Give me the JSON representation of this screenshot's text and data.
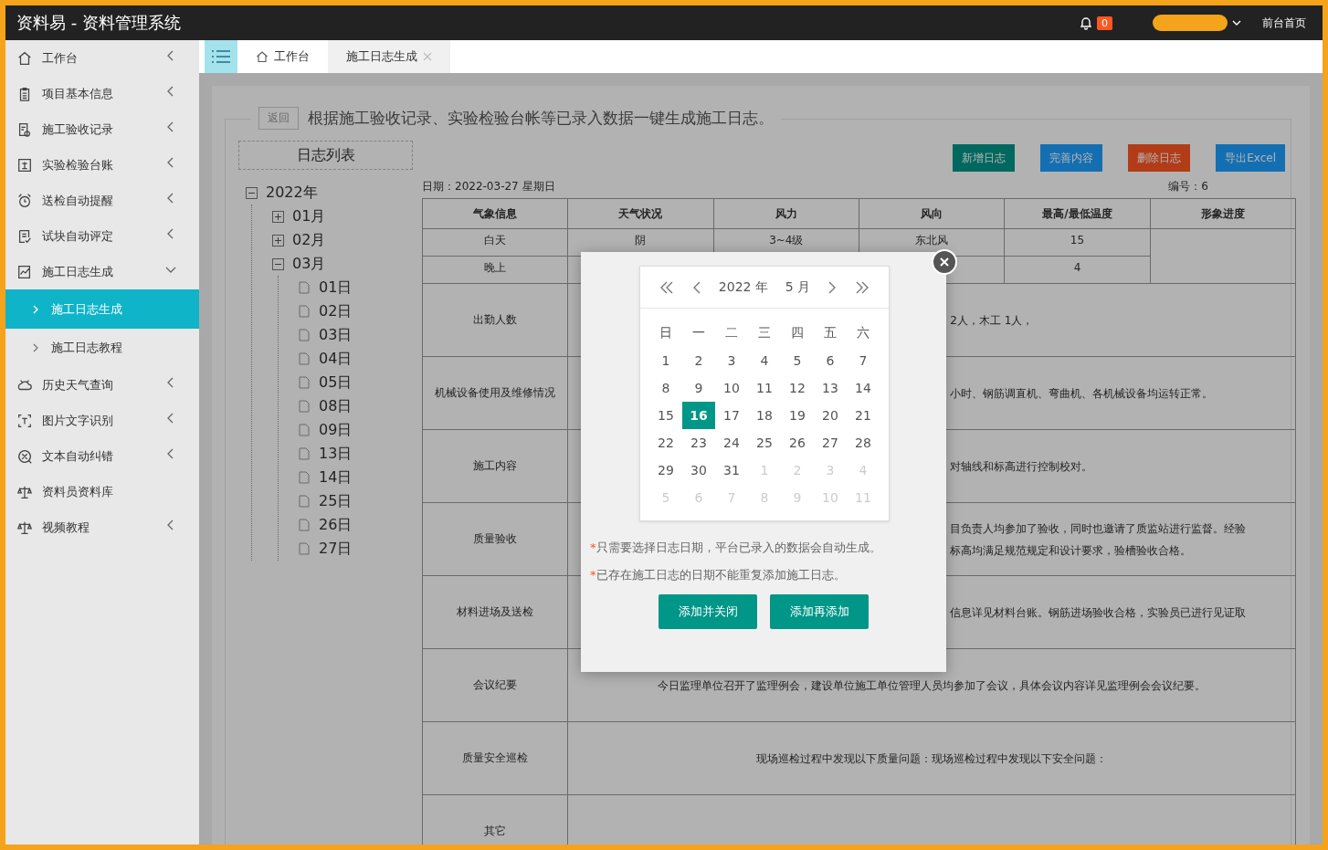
{
  "header": {
    "title": "资料易 - 资料管理系统",
    "notifications": "0",
    "home_link": "前台首页"
  },
  "sidebar": {
    "items": [
      {
        "label": "工作台",
        "expanded": false
      },
      {
        "label": "项目基本信息",
        "expanded": false
      },
      {
        "label": "施工验收记录",
        "expanded": false
      },
      {
        "label": "实验检验台账",
        "expanded": false
      },
      {
        "label": "送检自动提醒",
        "expanded": false
      },
      {
        "label": "试块自动评定",
        "expanded": false
      },
      {
        "label": "施工日志生成",
        "expanded": true,
        "children": [
          {
            "label": "施工日志生成",
            "selected": true
          },
          {
            "label": "施工日志教程",
            "selected": false
          }
        ]
      },
      {
        "label": "历史天气查询",
        "expanded": false
      },
      {
        "label": "图片文字识别",
        "expanded": false
      },
      {
        "label": "文本自动纠错",
        "expanded": false
      },
      {
        "label": "资料员资料库"
      },
      {
        "label": "视频教程",
        "expanded": false
      }
    ]
  },
  "tabs": [
    {
      "label": "工作台",
      "kind": "home",
      "selected": false,
      "closable": false
    },
    {
      "label": "施工日志生成",
      "kind": "page",
      "selected": true,
      "closable": true
    }
  ],
  "page": {
    "back_button": "返回",
    "intro": "根据施工验收记录、实验检验台帐等已录入数据一键生成施工日志。",
    "log_list_title": "日志列表",
    "tree": [
      {
        "label": "2022年",
        "expanded": true,
        "children": [
          {
            "label": "01月",
            "expanded": false
          },
          {
            "label": "02月",
            "expanded": false
          },
          {
            "label": "03月",
            "expanded": true,
            "children": [
              {
                "label": "01日"
              },
              {
                "label": "02日"
              },
              {
                "label": "03日"
              },
              {
                "label": "04日"
              },
              {
                "label": "05日"
              },
              {
                "label": "08日"
              },
              {
                "label": "09日"
              },
              {
                "label": "13日"
              },
              {
                "label": "14日"
              },
              {
                "label": "25日"
              },
              {
                "label": "26日"
              },
              {
                "label": "27日"
              }
            ]
          }
        ]
      }
    ],
    "actions": [
      {
        "label": "新增日志",
        "kind": "primary"
      },
      {
        "label": "完善内容",
        "kind": "normal"
      },
      {
        "label": "删除日志",
        "kind": "danger"
      },
      {
        "label": "导出Excel",
        "kind": "normal"
      }
    ],
    "date": "日期：2022-03-27 星期日",
    "serial": "编号：6",
    "weather_table": {
      "columns": [
        "气象信息",
        "天气状况",
        "风力",
        "风向",
        "最高/最低温度",
        "形象进度"
      ],
      "rows": [
        {
          "period": "白天",
          "weather": "阴",
          "wind_force": "3~4级",
          "wind_direction": "东北风",
          "temperature": "15"
        },
        {
          "period": "晚上",
          "temperature": "4"
        }
      ]
    },
    "log_rows": [
      {
        "label": "出勤人数",
        "covered": true,
        "lines": [
          "2人，木工 1人，"
        ]
      },
      {
        "label": "机械设备使用及维修情况",
        "covered": true,
        "lines": [
          "小时、钢筋调直机、弯曲机、各机械设备均运转正常。"
        ]
      },
      {
        "label": "施工内容",
        "covered": true,
        "lines": [
          "对轴线和标高进行控制校对。"
        ]
      },
      {
        "label": "质量验收",
        "covered": true,
        "lines": [
          "目负责人均参加了验收，同时也邀请了质监站进行监督。经验",
          "标高均满足规范规定和设计要求，验槽验收合格。"
        ]
      },
      {
        "label": "材料进场及送检",
        "covered": true,
        "lines": [
          "信息详见材料台账。钢筋进场验收合格，实验员已进行见证取"
        ]
      },
      {
        "label": "会议纪要",
        "covered": false,
        "lines": [
          "今日监理单位召开了监理例会，建设单位施工单位管理人员均参加了会议，具体会议内容详见监理例会会议纪要。"
        ]
      },
      {
        "label": "质量安全巡检",
        "covered": false,
        "lines": [
          "现场巡检过程中发现以下质量问题：现场巡检过程中发现以下安全问题："
        ]
      },
      {
        "label": "其它",
        "lines": []
      }
    ]
  },
  "dialog": {
    "calendar": {
      "year": "2022 年",
      "month": "5 月",
      "weekdays": [
        "日",
        "一",
        "二",
        "三",
        "四",
        "五",
        "六"
      ],
      "weeks": [
        [
          {
            "label": "1",
            "other_month": false,
            "selected": false
          },
          {
            "label": "2",
            "other_month": false,
            "selected": false
          },
          {
            "label": "3",
            "other_month": false,
            "selected": false
          },
          {
            "label": "4",
            "other_month": false,
            "selected": false
          },
          {
            "label": "5",
            "other_month": false,
            "selected": false
          },
          {
            "label": "6",
            "other_month": false,
            "selected": false
          },
          {
            "label": "7",
            "other_month": false,
            "selected": false
          }
        ],
        [
          {
            "label": "8",
            "other_month": false,
            "selected": false
          },
          {
            "label": "9",
            "other_month": false,
            "selected": false
          },
          {
            "label": "10",
            "other_month": false,
            "selected": false
          },
          {
            "label": "11",
            "other_month": false,
            "selected": false
          },
          {
            "label": "12",
            "other_month": false,
            "selected": false
          },
          {
            "label": "13",
            "other_month": false,
            "selected": false
          },
          {
            "label": "14",
            "other_month": false,
            "selected": false
          }
        ],
        [
          {
            "label": "15",
            "other_month": false,
            "selected": false
          },
          {
            "label": "16",
            "other_month": false,
            "selected": true
          },
          {
            "label": "17",
            "other_month": false,
            "selected": false
          },
          {
            "label": "18",
            "other_month": false,
            "selected": false
          },
          {
            "label": "19",
            "other_month": false,
            "selected": false
          },
          {
            "label": "20",
            "other_month": false,
            "selected": false
          },
          {
            "label": "21",
            "other_month": false,
            "selected": false
          }
        ],
        [
          {
            "label": "22",
            "other_month": false,
            "selected": false
          },
          {
            "label": "23",
            "other_month": false,
            "selected": false
          },
          {
            "label": "24",
            "other_month": false,
            "selected": false
          },
          {
            "label": "25",
            "other_month": false,
            "selected": false
          },
          {
            "label": "26",
            "other_month": false,
            "selected": false
          },
          {
            "label": "27",
            "other_month": false,
            "selected": false
          },
          {
            "label": "28",
            "other_month": false,
            "selected": false
          }
        ],
        [
          {
            "label": "29",
            "other_month": false,
            "selected": false
          },
          {
            "label": "30",
            "other_month": false,
            "selected": false
          },
          {
            "label": "31",
            "other_month": false,
            "selected": false
          },
          {
            "label": "1",
            "other_month": true,
            "selected": false
          },
          {
            "label": "2",
            "other_month": true,
            "selected": false
          },
          {
            "label": "3",
            "other_month": true,
            "selected": false
          },
          {
            "label": "4",
            "other_month": true,
            "selected": false
          }
        ],
        [
          {
            "label": "5",
            "other_month": true,
            "selected": false
          },
          {
            "label": "6",
            "other_month": true,
            "selected": false
          },
          {
            "label": "7",
            "other_month": true,
            "selected": false
          },
          {
            "label": "8",
            "other_month": true,
            "selected": false
          },
          {
            "label": "9",
            "other_month": true,
            "selected": false
          },
          {
            "label": "10",
            "other_month": true,
            "selected": false
          },
          {
            "label": "11",
            "other_month": true,
            "selected": false
          }
        ]
      ]
    },
    "notes": [
      {
        "mark": "*",
        "text": "只需要选择日志日期，平台已录入的数据会自动生成。"
      },
      {
        "mark": "*",
        "text": "已存在施工日志的日期不能重复添加施工日志。"
      }
    ],
    "buttons": [
      "添加并关闭",
      "添加再添加"
    ]
  }
}
